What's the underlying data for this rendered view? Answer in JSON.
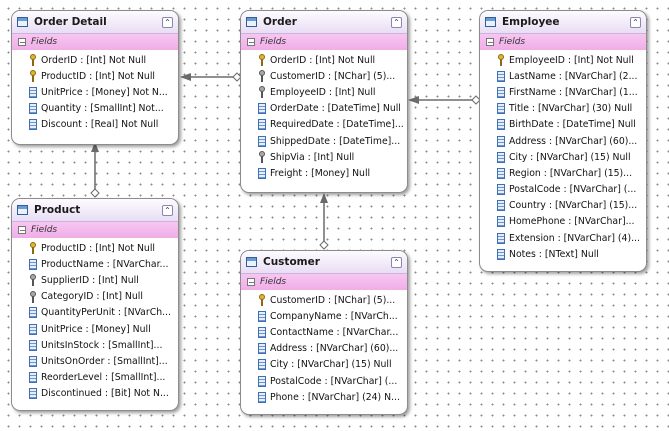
{
  "fields_label": "Fields",
  "entities": {
    "order_detail": {
      "title": "Order Detail",
      "fields": [
        {
          "text": "OrderID : [Int] Not Null",
          "icon": "key"
        },
        {
          "text": "ProductID : [Int] Not Null",
          "icon": "key"
        },
        {
          "text": "UnitPrice : [Money] Not N...",
          "icon": "column"
        },
        {
          "text": "Quantity : [SmallInt] Not...",
          "icon": "column"
        },
        {
          "text": "Discount : [Real] Not Null",
          "icon": "column"
        }
      ]
    },
    "order": {
      "title": "Order",
      "fields": [
        {
          "text": "OrderID : [Int] Not Null",
          "icon": "key"
        },
        {
          "text": "CustomerID : [NChar] (5)...",
          "icon": "foreign-key"
        },
        {
          "text": "EmployeeID : [Int] Null",
          "icon": "foreign-key"
        },
        {
          "text": "OrderDate : [DateTime] Null",
          "icon": "column"
        },
        {
          "text": "RequiredDate : [DateTime]...",
          "icon": "column"
        },
        {
          "text": "ShippedDate : [DateTime]...",
          "icon": "column"
        },
        {
          "text": "ShipVia : [Int] Null",
          "icon": "foreign-key"
        },
        {
          "text": "Freight : [Money] Null",
          "icon": "column"
        }
      ]
    },
    "employee": {
      "title": "Employee",
      "fields": [
        {
          "text": "EmployeeID : [Int] Not Null",
          "icon": "key"
        },
        {
          "text": "LastName : [NVarChar] (2...",
          "icon": "column"
        },
        {
          "text": "FirstName : [NVarChar] (1...",
          "icon": "column"
        },
        {
          "text": "Title : [NVarChar] (30) Null",
          "icon": "column"
        },
        {
          "text": "BirthDate : [DateTime] Null",
          "icon": "column"
        },
        {
          "text": "Address : [NVarChar] (60)...",
          "icon": "column"
        },
        {
          "text": "City : [NVarChar] (15) Null",
          "icon": "column"
        },
        {
          "text": "Region : [NVarChar] (15)...",
          "icon": "column"
        },
        {
          "text": "PostalCode : [NVarChar] (...",
          "icon": "column"
        },
        {
          "text": "Country : [NVarChar] (15)...",
          "icon": "column"
        },
        {
          "text": "HomePhone : [NVarChar]...",
          "icon": "column"
        },
        {
          "text": "Extension : [NVarChar] (4)...",
          "icon": "column"
        },
        {
          "text": "Notes : [NText] Null",
          "icon": "column"
        }
      ]
    },
    "product": {
      "title": "Product",
      "fields": [
        {
          "text": "ProductID : [Int] Not Null",
          "icon": "key"
        },
        {
          "text": "ProductName : [NVarChar...",
          "icon": "column"
        },
        {
          "text": "SupplierID : [Int] Null",
          "icon": "foreign-key"
        },
        {
          "text": "CategoryID : [Int] Null",
          "icon": "foreign-key"
        },
        {
          "text": "QuantityPerUnit : [NVarCh...",
          "icon": "column"
        },
        {
          "text": "UnitPrice : [Money] Null",
          "icon": "column"
        },
        {
          "text": "UnitsInStock : [SmallInt]...",
          "icon": "column"
        },
        {
          "text": "UnitsOnOrder : [SmallInt]...",
          "icon": "column"
        },
        {
          "text": "ReorderLevel : [SmallInt]...",
          "icon": "column"
        },
        {
          "text": "Discontinued : [Bit] Not N...",
          "icon": "column"
        }
      ]
    },
    "customer": {
      "title": "Customer",
      "fields": [
        {
          "text": "CustomerID : [NChar] (5)...",
          "icon": "key"
        },
        {
          "text": "CompanyName : [NVarCh...",
          "icon": "column"
        },
        {
          "text": "ContactName : [NVarChar...",
          "icon": "column"
        },
        {
          "text": "Address : [NVarChar] (60)...",
          "icon": "column"
        },
        {
          "text": "City : [NVarChar] (15) Null",
          "icon": "column"
        },
        {
          "text": "PostalCode : [NVarChar] (...",
          "icon": "column"
        },
        {
          "text": "Phone : [NVarChar] (24) N...",
          "icon": "column"
        }
      ]
    }
  },
  "relationships": [
    {
      "from": "order",
      "to": "order_detail"
    },
    {
      "from": "employee",
      "to": "order"
    },
    {
      "from": "product",
      "to": "order_detail"
    },
    {
      "from": "customer",
      "to": "order"
    }
  ]
}
